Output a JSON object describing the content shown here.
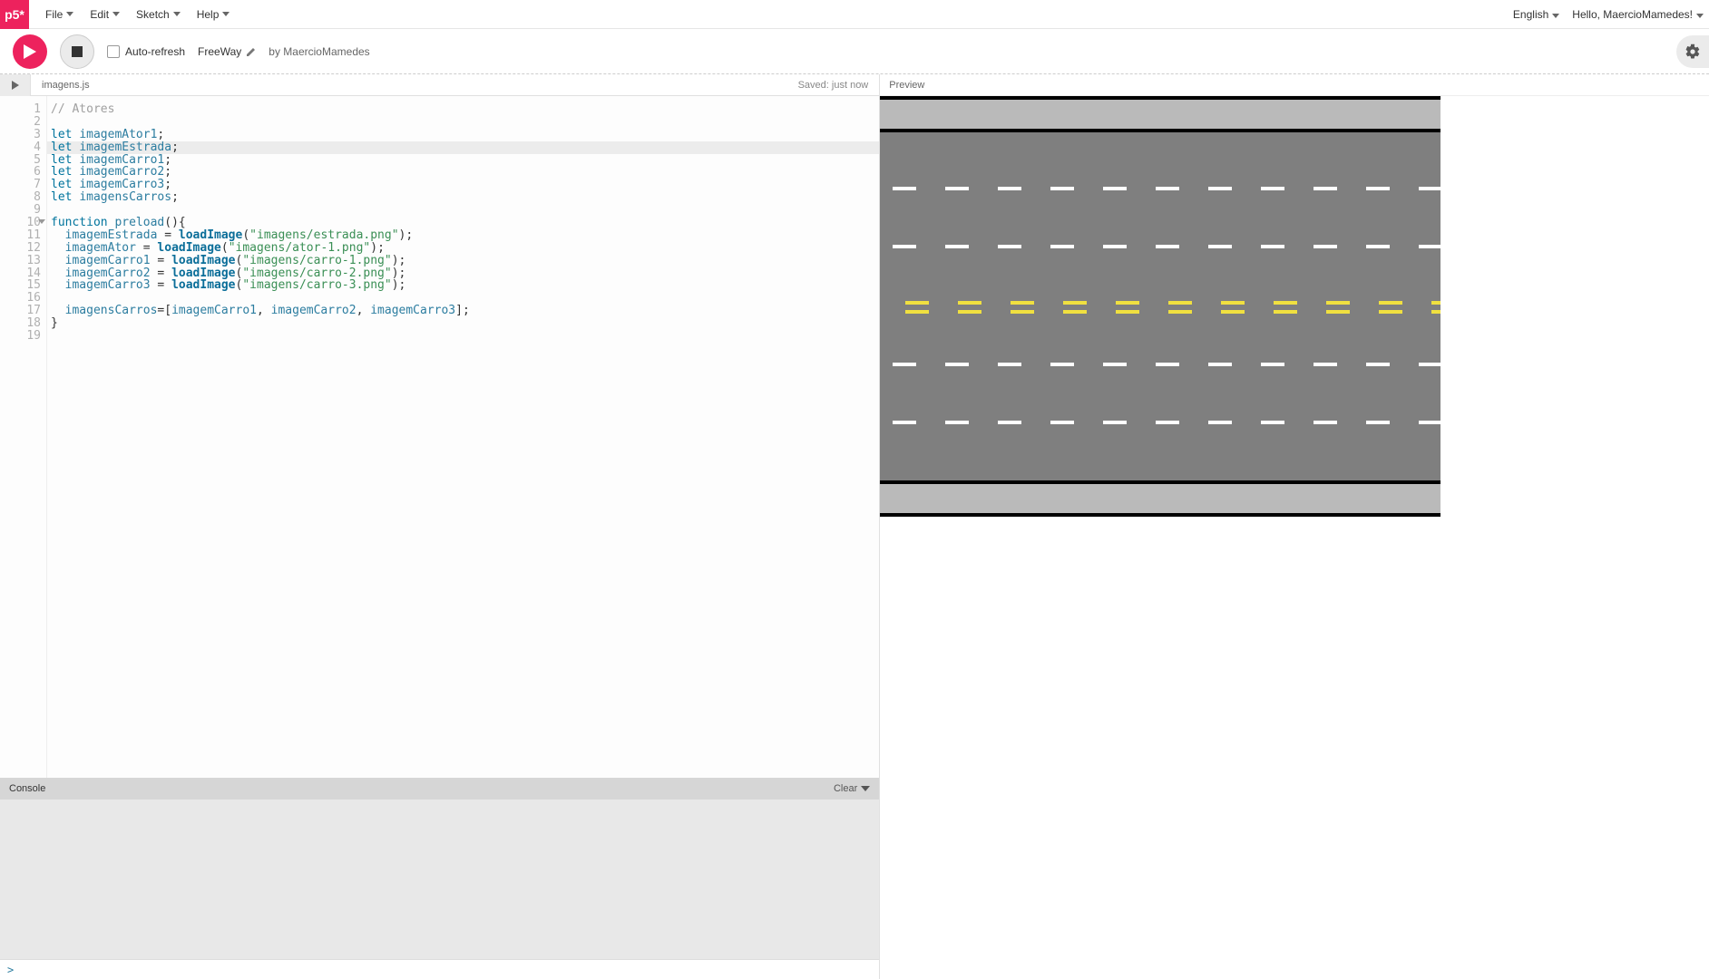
{
  "logo": "p5*",
  "menu": {
    "file": "File",
    "edit": "Edit",
    "sketch": "Sketch",
    "help": "Help"
  },
  "topbar": {
    "language": "English",
    "greeting": "Hello, MaercioMamedes!"
  },
  "toolbar": {
    "auto_refresh": "Auto-refresh",
    "sketch_name": "FreeWay",
    "by": "by",
    "author": "MaercioMamedes"
  },
  "tabs": {
    "filename": "imagens.js",
    "save_status": "Saved: just now"
  },
  "preview": {
    "label": "Preview"
  },
  "console": {
    "label": "Console",
    "clear": "Clear",
    "prompt": ">"
  },
  "code": {
    "lines": [
      [
        {
          "c": "c-comment",
          "t": "// Atores"
        }
      ],
      [],
      [
        {
          "c": "c-key",
          "t": "let"
        },
        {
          "t": " "
        },
        {
          "c": "c-var",
          "t": "imagemAtor1"
        },
        {
          "t": ";"
        }
      ],
      [
        {
          "c": "c-key",
          "t": "let"
        },
        {
          "t": " "
        },
        {
          "c": "c-var",
          "t": "imagemEstrada"
        },
        {
          "t": ";"
        }
      ],
      [
        {
          "c": "c-key",
          "t": "let"
        },
        {
          "t": " "
        },
        {
          "c": "c-var",
          "t": "imagemCarro1"
        },
        {
          "t": ";"
        }
      ],
      [
        {
          "c": "c-key",
          "t": "let"
        },
        {
          "t": " "
        },
        {
          "c": "c-var",
          "t": "imagemCarro2"
        },
        {
          "t": ";"
        }
      ],
      [
        {
          "c": "c-key",
          "t": "let"
        },
        {
          "t": " "
        },
        {
          "c": "c-var",
          "t": "imagemCarro3"
        },
        {
          "t": ";"
        }
      ],
      [
        {
          "c": "c-key",
          "t": "let"
        },
        {
          "t": " "
        },
        {
          "c": "c-var",
          "t": "imagensCarros"
        },
        {
          "t": ";"
        }
      ],
      [],
      [
        {
          "c": "c-key",
          "t": "function"
        },
        {
          "t": " "
        },
        {
          "c": "c-var",
          "t": "preload"
        },
        {
          "t": "(){"
        }
      ],
      [
        {
          "t": "  "
        },
        {
          "c": "c-var",
          "t": "imagemEstrada"
        },
        {
          "t": " = "
        },
        {
          "c": "c-func",
          "t": "loadImage"
        },
        {
          "t": "("
        },
        {
          "c": "c-str",
          "t": "\"imagens/estrada.png\""
        },
        {
          "t": ");"
        }
      ],
      [
        {
          "t": "  "
        },
        {
          "c": "c-var",
          "t": "imagemAtor"
        },
        {
          "t": " = "
        },
        {
          "c": "c-func",
          "t": "loadImage"
        },
        {
          "t": "("
        },
        {
          "c": "c-str",
          "t": "\"imagens/ator-1.png\""
        },
        {
          "t": ");"
        }
      ],
      [
        {
          "t": "  "
        },
        {
          "c": "c-var",
          "t": "imagemCarro1"
        },
        {
          "t": " = "
        },
        {
          "c": "c-func",
          "t": "loadImage"
        },
        {
          "t": "("
        },
        {
          "c": "c-str",
          "t": "\"imagens/carro-1.png\""
        },
        {
          "t": ");"
        }
      ],
      [
        {
          "t": "  "
        },
        {
          "c": "c-var",
          "t": "imagemCarro2"
        },
        {
          "t": " = "
        },
        {
          "c": "c-func",
          "t": "loadImage"
        },
        {
          "t": "("
        },
        {
          "c": "c-str",
          "t": "\"imagens/carro-2.png\""
        },
        {
          "t": ");"
        }
      ],
      [
        {
          "t": "  "
        },
        {
          "c": "c-var",
          "t": "imagemCarro3"
        },
        {
          "t": " = "
        },
        {
          "c": "c-func",
          "t": "loadImage"
        },
        {
          "t": "("
        },
        {
          "c": "c-str",
          "t": "\"imagens/carro-3.png\""
        },
        {
          "t": ");"
        }
      ],
      [],
      [
        {
          "t": "  "
        },
        {
          "c": "c-var",
          "t": "imagensCarros"
        },
        {
          "t": "=["
        },
        {
          "c": "c-var",
          "t": "imagemCarro1"
        },
        {
          "t": ", "
        },
        {
          "c": "c-var",
          "t": "imagemCarro2"
        },
        {
          "t": ", "
        },
        {
          "c": "c-var",
          "t": "imagemCarro3"
        },
        {
          "t": "];"
        }
      ],
      [
        {
          "t": "}"
        }
      ],
      []
    ],
    "highlighted_line": 4,
    "foldable_lines": [
      10
    ]
  }
}
